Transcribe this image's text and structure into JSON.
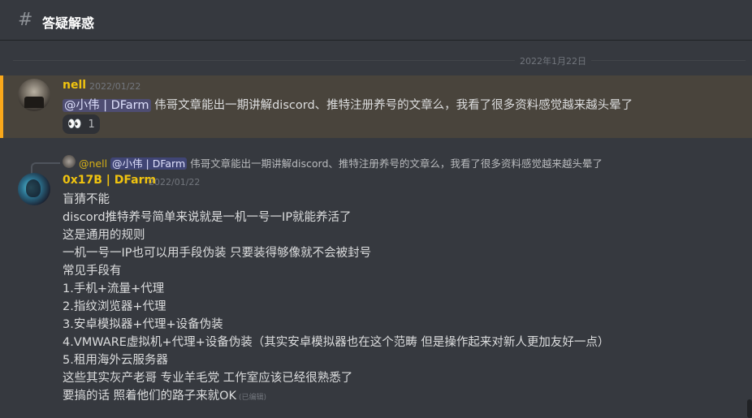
{
  "channel": {
    "icon": "hash-icon",
    "title": "答疑解惑"
  },
  "divider": {
    "date": "2022年1月22日"
  },
  "colors": {
    "accent_yellow": "#f1c40f",
    "highlight_bg": "#49443c",
    "highlight_border": "#faa81a",
    "mention_bg": "#5865f2"
  },
  "messages": [
    {
      "username": "nell",
      "timestamp": "2022/01/22",
      "mention": "@小伟 | DFarm",
      "text": " 伟哥文章能出一期讲解discord、推特注册养号的文章么，我看了很多资料感觉越来越头晕了",
      "reaction": {
        "emoji": "👀",
        "count": "1"
      }
    },
    {
      "reply": {
        "username": "@nell",
        "mention": "@小伟 | DFarm",
        "text": " 伟哥文章能出一期讲解discord、推特注册养号的文章么，我看了很多资料感觉越来越头晕了"
      },
      "username": "0x17B | DFarm",
      "timestamp": "2022/01/22",
      "lines": [
        "盲猜不能",
        "discord推特养号简单来说就是一机一号一IP就能养活了",
        "这是通用的规则",
        "一机一号一IP也可以用手段伪装 只要装得够像就不会被封号",
        "常见手段有",
        "1.手机+流量+代理",
        "2.指纹浏览器+代理",
        "3.安卓模拟器+代理+设备伪装",
        "4.VMWARE虚拟机+代理+设备伪装（其实安卓模拟器也在这个范畴 但是操作起来对新人更加友好一点）",
        "5.租用海外云服务器",
        "这些其实灰产老哥 专业羊毛党 工作室应该已经很熟悉了",
        "要搞的话 照着他们的路子来就OK"
      ],
      "edited": "(已编辑)"
    }
  ]
}
